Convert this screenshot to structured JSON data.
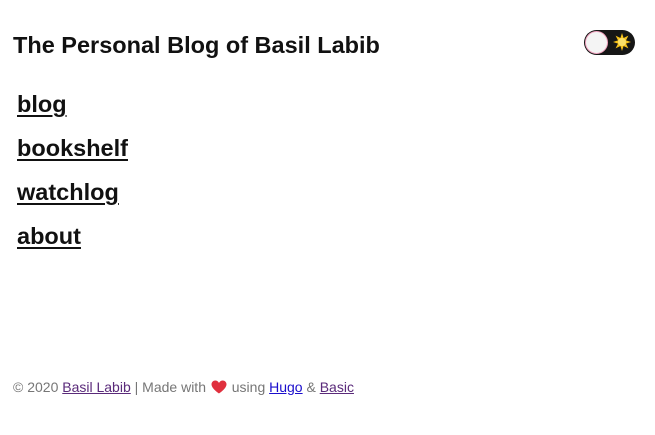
{
  "header": {
    "site_title": "The Personal Blog of Basil Labib",
    "theme_toggle": {
      "icon": "sun-icon",
      "state": "light",
      "track_color": "#161616",
      "knob_border_color": "#f2a4c0"
    }
  },
  "nav": {
    "items": [
      {
        "label": "blog"
      },
      {
        "label": "bookshelf"
      },
      {
        "label": "watchlog"
      },
      {
        "label": "about"
      }
    ]
  },
  "footer": {
    "copyright": "© 2020",
    "author_link": "Basil Labib",
    "made_with": "| Made with",
    "heart_icon": "heart-icon",
    "using": "using",
    "hugo_link": "Hugo",
    "ampersand": "&",
    "theme_link": "Basic"
  },
  "colors": {
    "text": "#111111",
    "footer_text": "#767676",
    "visited_link": "#5a2a7a",
    "link": "#1a0dcc",
    "heart": "#e0303e"
  }
}
